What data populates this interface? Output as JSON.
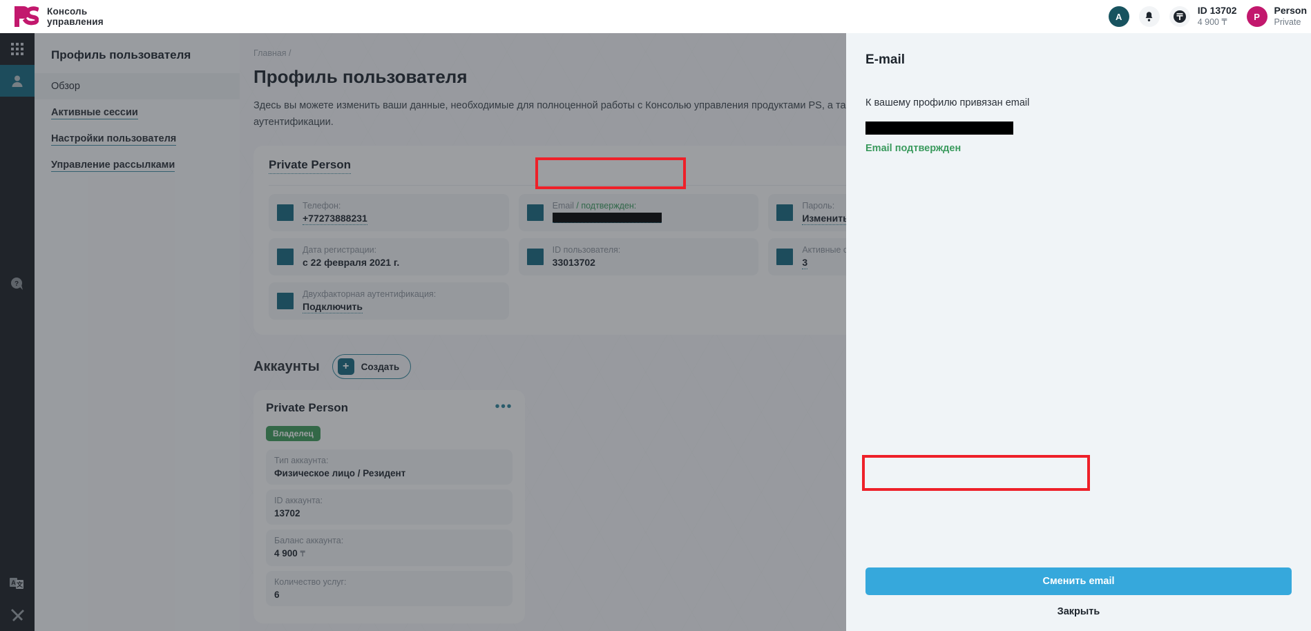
{
  "topbar": {
    "logo_text_line1": "Консоль",
    "logo_text_line2": "управления",
    "logo_mark": "ps-logo",
    "account_avatar_letter": "A",
    "bell_icon": "bell-icon",
    "balance_icon": "tenge-icon",
    "balance_id": "ID 13702",
    "balance_amount": "4 900 ₸",
    "person_avatar_letter": "P",
    "person_name": "Person",
    "person_type": "Private"
  },
  "rail": {
    "apps_icon": "apps-grid-icon",
    "profile_icon": "user-icon",
    "help_icon": "help-bubble-icon",
    "language_icon": "translate-icon",
    "tools_icon": "tools-icon"
  },
  "sidebar": {
    "title": "Профиль пользователя",
    "items": [
      {
        "label": "Обзор",
        "active": true
      },
      {
        "label": "Активные сессии",
        "active": false
      },
      {
        "label": "Настройки пользователя",
        "active": false
      },
      {
        "label": "Управление рассылками",
        "active": false
      }
    ]
  },
  "main": {
    "breadcrumb": "Главная  /",
    "page_title": "Профиль пользователя",
    "page_desc": "Здесь вы можете изменить ваши данные, необходимые для полноценной работы с Консолью управления продуктами PS, а также з помощью двухфакторной аутентификации.",
    "profile_card": {
      "title": "Private Person",
      "fields": [
        {
          "label": "Телефон:",
          "value": "+77273888231",
          "redacted": false,
          "dotted": true
        },
        {
          "label": "Email",
          "label_suffix": " / подтвержден:",
          "value": "",
          "redacted": true,
          "dotted": true
        },
        {
          "label": "Пароль:",
          "value": "Изменить",
          "redacted": false,
          "dotted": true
        },
        {
          "label": "Дата регистрации:",
          "value": "с 22 февраля 2021 г.",
          "redacted": false,
          "dotted": false
        },
        {
          "label": "ID пользователя:",
          "value": "33013702",
          "redacted": false,
          "dotted": false
        },
        {
          "label": "Активные сессии:",
          "value": "3",
          "redacted": false,
          "dotted": true
        },
        {
          "label": "Двухфакторная аутентификация:",
          "value": "Подключить",
          "redacted": false,
          "dotted": true
        }
      ]
    },
    "accounts": {
      "title": "Аккаунты",
      "create_label": "Создать",
      "create_icon": "plus-icon",
      "card": {
        "title": "Private Person",
        "menu_icon": "ellipsis-icon",
        "badge": "Владелец",
        "fields": [
          {
            "label": "Тип аккаунта:",
            "value": "Физическое лицо  / Резидент",
            "unit": ""
          },
          {
            "label": "ID аккаунта:",
            "value": "13702",
            "unit": ""
          },
          {
            "label": "Баланс аккаунта:",
            "value": "4 900 ",
            "unit": "₸"
          },
          {
            "label": "Количество услуг:",
            "value": "6",
            "unit": ""
          }
        ]
      }
    }
  },
  "modal": {
    "title": "E-mail",
    "description": "К вашему профилю привязан email",
    "email_redacted": true,
    "status": "Email подтвержден",
    "primary_button": "Сменить email",
    "secondary_button": "Закрыть"
  },
  "annotations": {
    "email_field_highlight": "red-box",
    "primary_button_highlight": "red-box"
  },
  "colors": {
    "accent_teal": "#15677f",
    "brand_magenta": "#c2186d",
    "success_green": "#3a9a5d",
    "primary_blue": "#36a8dc",
    "annotation_red": "#ee2029"
  }
}
